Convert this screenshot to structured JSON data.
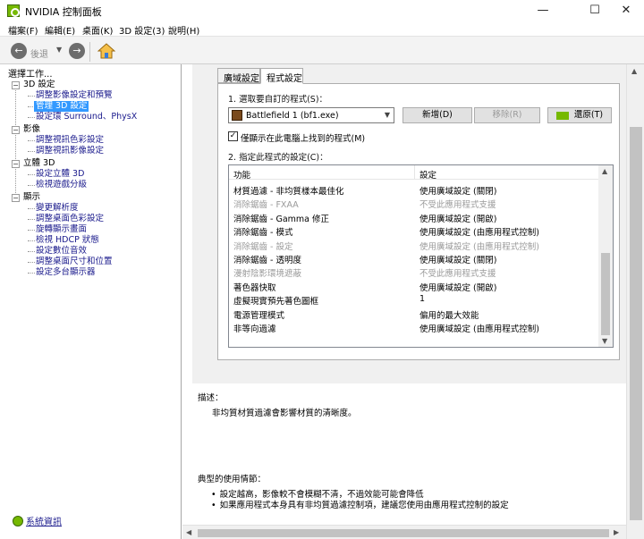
{
  "window": {
    "title": "NVIDIA 控制面板",
    "minimize_glyph": "—",
    "maximize_glyph": "☐",
    "close_glyph": "✕"
  },
  "menu": [
    "檔案(F)",
    "編輯(E)",
    "桌面(K)",
    "3D 設定(3)",
    "說明(H)"
  ],
  "toolbar": {
    "back_label": "後退",
    "back_glyph": "←",
    "forward_glyph": "→",
    "dropdown_glyph": "▼",
    "home_icon": "home-icon"
  },
  "left_panel": {
    "title": "選擇工作...",
    "tree": [
      {
        "label": "3D 設定",
        "type": "category",
        "toggle": "−"
      },
      {
        "label": "調整影像設定和預覽",
        "type": "link"
      },
      {
        "label": "管理 3D 設定",
        "type": "link",
        "selected": true
      },
      {
        "label": "設定環 Surround、PhysX",
        "type": "link"
      },
      {
        "label": "影像",
        "type": "category",
        "toggle": "−"
      },
      {
        "label": "調整視訊色彩設定",
        "type": "link"
      },
      {
        "label": "調整視訊影像設定",
        "type": "link"
      },
      {
        "label": "立體 3D",
        "type": "category",
        "toggle": "−"
      },
      {
        "label": "設定立體 3D",
        "type": "link"
      },
      {
        "label": "檢視遊戲分級",
        "type": "link"
      },
      {
        "label": "顯示",
        "type": "category",
        "toggle": "−"
      },
      {
        "label": "變更解析度",
        "type": "link"
      },
      {
        "label": "調整桌面色彩設定",
        "type": "link"
      },
      {
        "label": "旋轉顯示畫面",
        "type": "link"
      },
      {
        "label": "檢視 HDCP 狀態",
        "type": "link"
      },
      {
        "label": "設定數位音效",
        "type": "link"
      },
      {
        "label": "調整桌面尺寸和位置",
        "type": "link"
      },
      {
        "label": "設定多台顯示器",
        "type": "link"
      }
    ],
    "system_info": "系統資訊"
  },
  "tabs": {
    "global": "廣域設定",
    "program": "程式設定"
  },
  "program_settings": {
    "step1": "1. 選取要自訂的程式(S)：",
    "selected_program": "Battlefield 1 (bf1.exe)",
    "add_button": "新增(D)",
    "remove_button": "移除(R)",
    "restore_button": "還原(T)",
    "show_only_found_label": "僅顯示在此電腦上找到的程式(M)",
    "show_only_found_checked": "✓",
    "step2": "2. 指定此程式的設定(C)：",
    "table_headers": {
      "feature": "功能",
      "setting": "設定"
    },
    "rows": [
      {
        "feature": "材質過濾 - 非均質樣本最佳化",
        "setting": "使用廣域設定 (關閉)",
        "dim": false
      },
      {
        "feature": "消除鋸齒 - FXAA",
        "setting": "不受此應用程式支援",
        "dim": true
      },
      {
        "feature": "消除鋸齒 - Gamma 修正",
        "setting": "使用廣域設定 (開啟)",
        "dim": false
      },
      {
        "feature": "消除鋸齒 - 模式",
        "setting": "使用廣域設定 (由應用程式控制)",
        "dim": false
      },
      {
        "feature": "消除鋸齒 - 設定",
        "setting": "使用廣域設定 (由應用程式控制)",
        "dim": true
      },
      {
        "feature": "消除鋸齒 - 透明度",
        "setting": "使用廣域設定 (關閉)",
        "dim": false
      },
      {
        "feature": "漫射陰影環境遮蔽",
        "setting": "不受此應用程式支援",
        "dim": true
      },
      {
        "feature": "著色器快取",
        "setting": "使用廣域設定 (開啟)",
        "dim": false
      },
      {
        "feature": "虛擬現實預先著色圖框",
        "setting": "1",
        "dim": false
      },
      {
        "feature": "電源管理模式",
        "setting": "偏用的最大效能",
        "dim": false
      },
      {
        "feature": "非等向過濾",
        "setting": "使用廣域設定 (由應用程式控制)",
        "dim": false
      }
    ]
  },
  "description": {
    "title": "描述：",
    "text": "非均質材質過濾會影響材質的清晰度。"
  },
  "usage": {
    "title": "典型的使用情節：",
    "bullet": "•",
    "items": [
      "設定越高，影像較不會模糊不清，不過效能可能會降低",
      "如果應用程式本身具有非均質過濾控制項，建議您使用由應用程式控制的設定"
    ]
  },
  "colors": {
    "nvidia_green": "#76b900",
    "selection_blue": "#3399ff",
    "link_blue": "#1a1a8c"
  }
}
